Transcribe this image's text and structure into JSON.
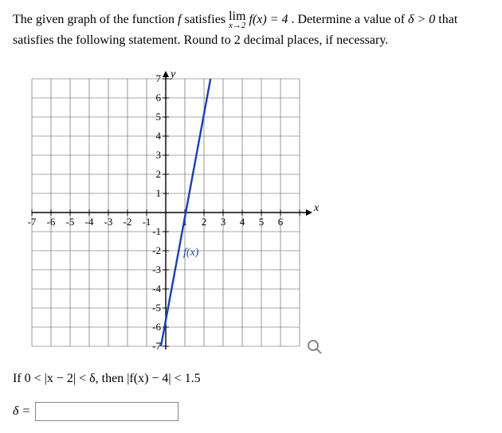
{
  "prompt": {
    "part1": "The given graph of the function ",
    "fn": "f",
    "part2": " satisfies ",
    "lim_top": "lim",
    "lim_sub": "x→2",
    "lim_expr": " f(x) = 4",
    "part3": ". Determine a value of ",
    "delta": "δ > 0",
    "part4": " that satisfies the following statement. Round to 2 decimal places, if necessary."
  },
  "chart_data": {
    "type": "line",
    "xlabel": "x",
    "ylabel": "y",
    "x_ticks": [
      -7,
      -6,
      -5,
      -4,
      -3,
      -2,
      -1,
      1,
      2,
      3,
      4,
      5,
      6
    ],
    "y_ticks": [
      -7,
      -6,
      -5,
      -4,
      -3,
      -2,
      -1,
      1,
      2,
      3,
      4,
      5,
      6,
      7
    ],
    "xlim": [
      -7,
      7
    ],
    "ylim": [
      -7,
      7
    ],
    "series": [
      {
        "name": "f(x)",
        "points": [
          [
            -0.25,
            -7
          ],
          [
            2.34,
            7
          ]
        ],
        "color": "#1b3fb5"
      }
    ],
    "fx_label": "f(x)",
    "fx_label_pos": [
      0.95,
      -2
    ]
  },
  "statement": {
    "text_before": "If 0 < |x − 2| < δ, then |f(x) − 4| < ",
    "eps": "1.5"
  },
  "answer": {
    "label": "δ =",
    "value": ""
  }
}
